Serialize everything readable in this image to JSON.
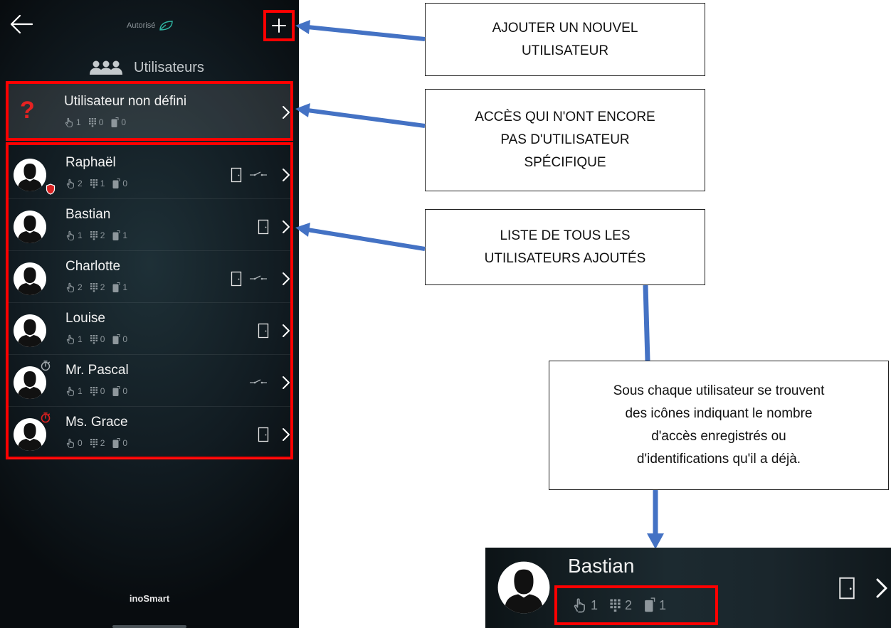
{
  "app": {
    "status_label": "Autorisé",
    "section_title": "Utilisateurs",
    "brand": "inoSmart"
  },
  "undefined_user": {
    "label": "Utilisateur non défini",
    "fingerprints": "1",
    "codes": "0",
    "phones": "0"
  },
  "users": [
    {
      "name": "Raphaël",
      "fingerprints": "2",
      "codes": "1",
      "phones": "0",
      "badge": "shield-icon",
      "door": true,
      "relay": true
    },
    {
      "name": "Bastian",
      "fingerprints": "1",
      "codes": "2",
      "phones": "1",
      "badge": "",
      "door": true,
      "relay": false
    },
    {
      "name": "Charlotte",
      "fingerprints": "2",
      "codes": "2",
      "phones": "1",
      "badge": "",
      "door": true,
      "relay": true
    },
    {
      "name": "Louise",
      "fingerprints": "1",
      "codes": "0",
      "phones": "0",
      "badge": "",
      "door": true,
      "relay": false
    },
    {
      "name": "Mr. Pascal",
      "fingerprints": "1",
      "codes": "0",
      "phones": "0",
      "badge": "timer-icon",
      "door": false,
      "relay": true
    },
    {
      "name": "Ms. Grace",
      "fingerprints": "0",
      "codes": "2",
      "phones": "0",
      "badge": "timer-red-icon",
      "door": true,
      "relay": false
    }
  ],
  "callouts": {
    "add_user": [
      "AJOUTER UN NOUVEL",
      "UTILISATEUR"
    ],
    "undefined_access": [
      "ACCÈS QUI N'ONT ENCORE",
      "PAS D'UTILISATEUR",
      "SPÉCIFIQUE"
    ],
    "user_list": [
      "LISTE DE TOUS LES",
      "UTILISATEURS AJOUTÉS"
    ],
    "icons_explanation": [
      "Sous chaque utilisateur se trouvent",
      "des icônes indiquant le nombre",
      "d'accès enregistrés ou",
      "d'identifications qu'il a déjà."
    ]
  },
  "zoom": {
    "name": "Bastian",
    "fingerprints": "1",
    "codes": "2",
    "phones": "1"
  },
  "colors": {
    "highlight": "#ff0000",
    "arrow": "#4472c4",
    "question_mark": "#e52222",
    "badge_red": "#d92323"
  }
}
